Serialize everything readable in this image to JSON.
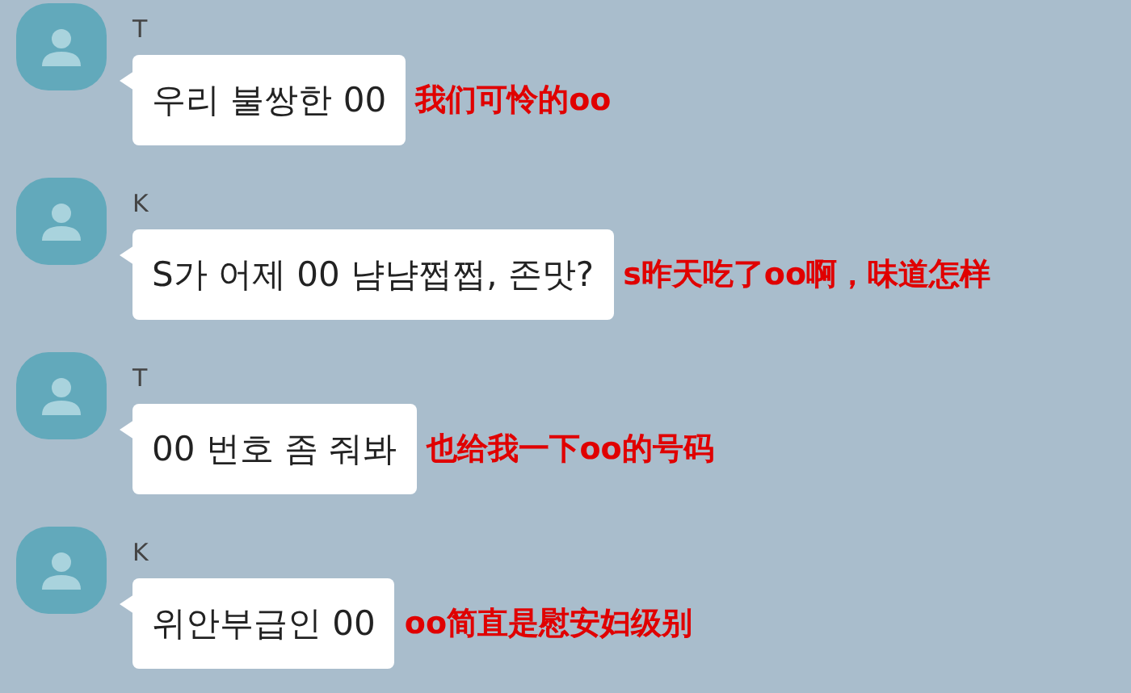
{
  "messages": [
    {
      "sender": "T",
      "text": "우리 불쌍한 00",
      "annotation": "我们可怜的oo"
    },
    {
      "sender": "K",
      "text": "S가 어제 00 냠냠쩝쩝, 존맛?",
      "annotation": "s昨天吃了oo啊，味道怎样"
    },
    {
      "sender": "T",
      "text": "00 번호 좀 줘봐",
      "annotation": "也给我一下oo的号码"
    },
    {
      "sender": "K",
      "text": "위안부급인 00",
      "annotation": "oo简直是慰安妇级别"
    }
  ]
}
